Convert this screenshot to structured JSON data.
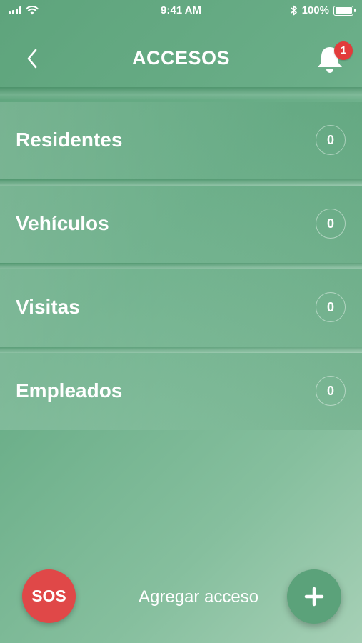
{
  "status_bar": {
    "time": "9:41 AM",
    "battery_percent": "100%",
    "icons": [
      "signal-icon",
      "wifi-icon",
      "bluetooth-icon",
      "battery-icon"
    ]
  },
  "header": {
    "title": "ACCESOS",
    "back_icon": "chevron-left-icon",
    "notification_icon": "bell-icon",
    "notification_count": "1"
  },
  "access_list": [
    {
      "label": "Residentes",
      "count": "0"
    },
    {
      "label": "Vehículos",
      "count": "0"
    },
    {
      "label": "Visitas",
      "count": "0"
    },
    {
      "label": "Empleados",
      "count": "0"
    }
  ],
  "footer": {
    "sos_label": "SOS",
    "add_label": "Agregar acceso",
    "add_icon": "plus-icon"
  },
  "colors": {
    "background": "#6aae88",
    "sos": "#e04848",
    "badge": "#e23b3b",
    "fab": "#5ba27a"
  }
}
